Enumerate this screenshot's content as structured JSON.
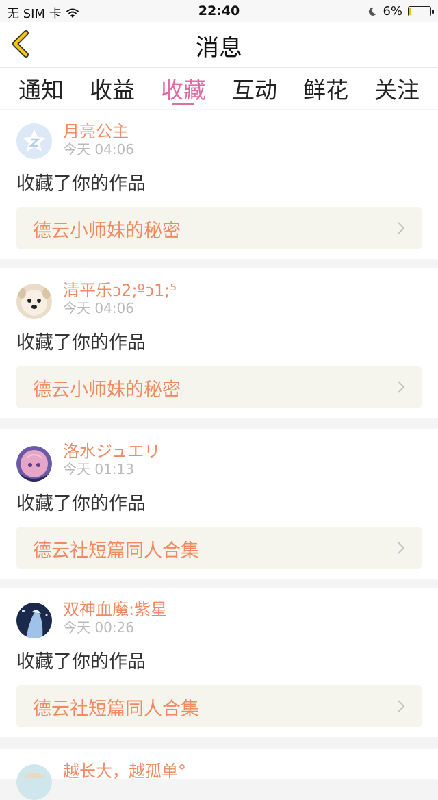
{
  "status_bar": {
    "carrier": "无 SIM 卡",
    "time": "22:40",
    "battery_text": "6%",
    "battery_level": 0.06,
    "battery_color": "#f2c200"
  },
  "navbar": {
    "title": "消息",
    "back_icon": "chevron-left-icon",
    "accent": "#f5c518"
  },
  "tabs": [
    {
      "label": "通知"
    },
    {
      "label": "收益"
    },
    {
      "label": "收藏",
      "active": true
    },
    {
      "label": "互动"
    },
    {
      "label": "鲜花"
    },
    {
      "label": "关注"
    }
  ],
  "colors": {
    "active_tab": "#e36aa3",
    "name": "#f08a63",
    "work_bg": "#f5f5ed"
  },
  "notifications": [
    {
      "user": "月亮公主",
      "time": "今天 04:06",
      "action": "收藏了你的作品",
      "work": "德云小师妹的秘密",
      "avatar": "default-avatar"
    },
    {
      "user": "清平乐ↄ2;ºↄ1;⁵",
      "time": "今天 04:06",
      "action": "收藏了你的作品",
      "work": "德云小师妹的秘密",
      "avatar": "dog-avatar"
    },
    {
      "user": "洛水ジュエリ",
      "time": "今天 01:13",
      "action": "收藏了你的作品",
      "work": "德云社短篇同人合集",
      "avatar": "anime-girl-avatar"
    },
    {
      "user": "双神血魔:紫星",
      "time": "今天 00:26",
      "action": "收藏了你的作品",
      "work": "德云社短篇同人合集",
      "avatar": "anime-blue-avatar"
    },
    {
      "user": "越长大，越孤单°",
      "time": "",
      "action": "",
      "work": "",
      "avatar": "partial-avatar"
    }
  ]
}
